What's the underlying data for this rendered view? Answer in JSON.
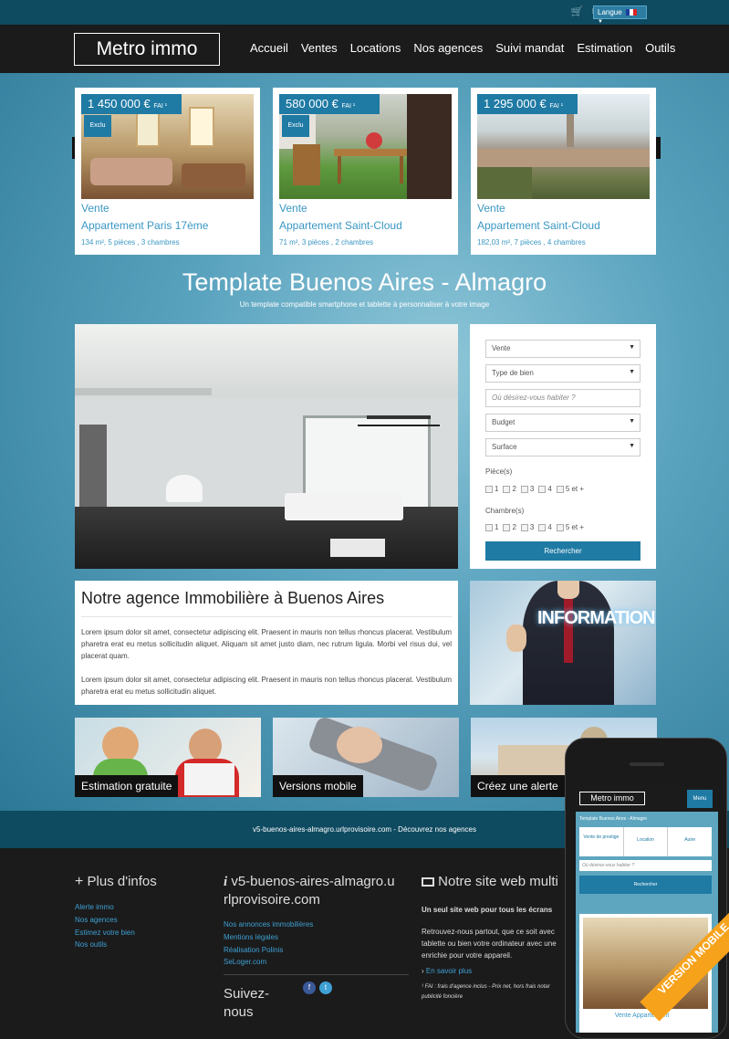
{
  "topbar": {
    "icons": [
      "cart-icon",
      "mail-icon",
      "facebook-icon",
      "twitter-icon",
      "rss-icon"
    ],
    "lang_label": "Langue"
  },
  "header": {
    "logo": "Metro immo",
    "nav": [
      "Accueil",
      "Ventes",
      "Locations",
      "Nos agences",
      "Suivi mandat",
      "Estimation",
      "Outils"
    ]
  },
  "listings": [
    {
      "price": "1 450 000 €",
      "price_suffix": "FAI ¹",
      "badge": "Exclu",
      "kind": "Vente",
      "title": "Appartement Paris 17ème",
      "specs": "134 m², 5 pièces , 3 chambres"
    },
    {
      "price": "580 000 €",
      "price_suffix": "FAI ¹",
      "badge": "Exclu",
      "kind": "Vente",
      "title": "Appartement Saint-Cloud",
      "specs": "71 m², 3 pièces , 2 chambres"
    },
    {
      "price": "1 295 000 €",
      "price_suffix": "FAI ¹",
      "badge": "",
      "kind": "Vente",
      "title": "Appartement Saint-Cloud",
      "specs": "182,03 m², 7 pièces , 4 chambres"
    }
  ],
  "hero": {
    "title": "Template Buenos Aires - Almagro",
    "subtitle": "Un template compatible smartphone et tablette à personnaliser à votre image"
  },
  "search": {
    "transaction": "Vente",
    "type": "Type de bien",
    "location_placeholder": "Où désirez-vous habiter ?",
    "budget": "Budget",
    "surface": "Surface",
    "rooms_label": "Pièce(s)",
    "bedrooms_label": "Chambre(s)",
    "options": [
      "1",
      "2",
      "3",
      "4",
      "5 et +"
    ],
    "button": "Rechercher"
  },
  "about": {
    "title": "Notre agence Immobilière à Buenos Aires",
    "p1": "Lorem ipsum dolor sit amet, consectetur adipiscing elit. Praesent in mauris non tellus rhoncus placerat. Vestibulum pharetra erat eu metus sollicitudin aliquet. Aliquam sit amet justo diam, nec rutrum ligula. Morbi vel risus dui, vel placerat quam.",
    "p2": "Lorem ipsum dolor sit amet, consectetur adipiscing elit. Praesent in mauris non tellus rhoncus placerat. Vestibulum pharetra erat eu metus sollicitudin aliquet.",
    "info_word": "INFORMATION"
  },
  "features": [
    "Estimation gratuite",
    "Versions mobile",
    "Créez une alerte"
  ],
  "strip": "v5-buenos-aires-almagro.urlprovisoire.com - Découvrez nos agences",
  "footer": {
    "col1": {
      "title": "Plus d'infos",
      "links": [
        "Alerte immo",
        "Nos agences",
        "Estimez votre bien",
        "Nos outils"
      ]
    },
    "col2": {
      "title": "v5-buenos-aires-almagro.urlprovisoire.com",
      "links": [
        "Nos annonces immobilières",
        "Mentions légales",
        "Réalisation Polinis",
        "SeLoger.com"
      ],
      "follow": "Suivez-nous"
    },
    "col3": {
      "title": "Notre site web multi",
      "subtitle": "Un seul site web pour tous les écrans",
      "text": "Retrouvez-nous partout, que ce soit avec tablette ou bien votre ordinateur avec une enrichie pour votre appareil.",
      "more": "En savoir plus",
      "note": "¹ FAI : frais d'agence inclus - Prix net, hors frais notar publicité foncière"
    }
  },
  "phone": {
    "logo": "Metro immo",
    "menu": "Menu",
    "subtitle": "Template Buenos Aires - Almagro",
    "tabs": [
      "Vente de prestige",
      "Location",
      "Autre"
    ],
    "placeholder": "Où désirez-vous habiter ?",
    "button": "Rechercher",
    "listing": "Vente Appartement",
    "ribbon": "VERSION MOBILE"
  },
  "colors": {
    "accent": "#1f7aa4",
    "link": "#3a97c3",
    "dark": "#1b1b1b",
    "strip": "#0e4a60",
    "ribbon": "#f7a21b"
  }
}
